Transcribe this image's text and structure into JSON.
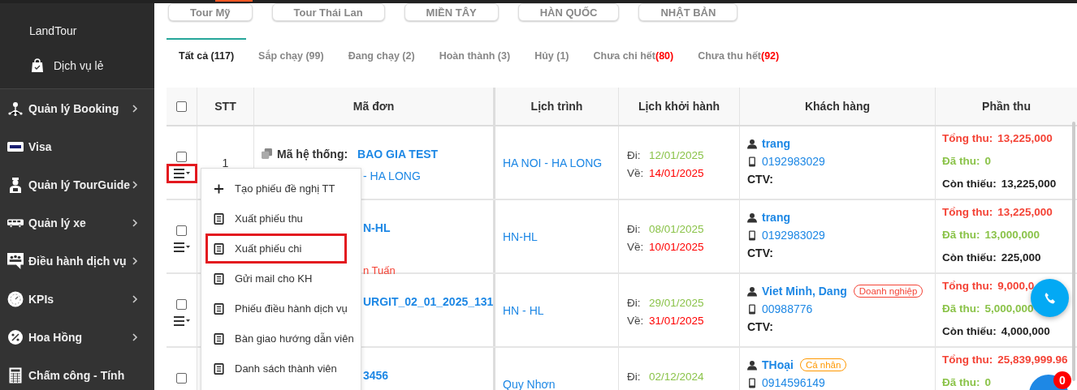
{
  "sidebar": {
    "brand_items": [
      {
        "label": "LandTour"
      },
      {
        "label": "Dịch vụ lẻ"
      }
    ],
    "items": [
      {
        "label": "Quản lý Booking",
        "has_submenu": true
      },
      {
        "label": "Visa",
        "has_submenu": false
      },
      {
        "label": "Quản lý TourGuide",
        "has_submenu": true
      },
      {
        "label": "Quản lý xe",
        "has_submenu": true
      },
      {
        "label": "Điều hành dịch vụ",
        "has_submenu": true
      },
      {
        "label": "KPIs",
        "has_submenu": true
      },
      {
        "label": "Hoa Hồng",
        "has_submenu": true
      },
      {
        "label": "Chấm công - Tính",
        "has_submenu": false
      }
    ]
  },
  "category_buttons": [
    {
      "label": "Tour Mỹ"
    },
    {
      "label": "Tour Thái Lan"
    },
    {
      "label": "MIỀN TÂY"
    },
    {
      "label": "HÀN QUỐC"
    },
    {
      "label": "NHẬT BẢN"
    }
  ],
  "status_tabs": [
    {
      "label": "Tất cả (117)",
      "selected": true
    },
    {
      "label": "Sắp chạy (99)",
      "selected": false
    },
    {
      "label": "Đang chạy (2)",
      "selected": false
    },
    {
      "label": "Hoàn thành (3)",
      "selected": false
    },
    {
      "label": "Hủy (1)",
      "selected": false
    },
    {
      "label": "Chưa chi hết",
      "count": "(80)",
      "selected": false
    },
    {
      "label": "Chưa thu hết",
      "count": "(92)",
      "selected": false
    }
  ],
  "table": {
    "select_all_checked": false,
    "columns": [
      "STT",
      "Mã đơn",
      "Lịch trình",
      "Lịch khởi hành",
      "Khách hàng",
      "Phần thu"
    ],
    "rows": [
      {
        "checked": false,
        "menu_toggle": {
          "highlighted": true
        },
        "stt": "1",
        "code_lines": [
          {
            "kind": "system",
            "label": "Mã hệ thống:",
            "value": "BAO GIA TEST"
          },
          {
            "kind": "tour",
            "value": "- HA LONG"
          }
        ],
        "route": "HA NOI - HA LONG",
        "departure": {
          "go_label": "Đi:",
          "go_date": "12/01/2025",
          "return_label": "Về:",
          "return_date": "14/01/2025"
        },
        "customer": {
          "name": "trang",
          "phone": "0192983029",
          "ctv_label": "CTV:"
        },
        "payment": [
          {
            "kind": "total",
            "label": "Tổng thu:",
            "value": "13,225,000"
          },
          {
            "kind": "paid",
            "label": "Đã thu:",
            "value": "0"
          },
          {
            "kind": "due",
            "label": "Còn thiếu:",
            "value": "13,225,000"
          }
        ]
      },
      {
        "checked": false,
        "menu_toggle": {
          "highlighted": false
        },
        "code_lines": [
          {
            "kind": "code",
            "value": "N-HL"
          },
          {
            "kind": "note",
            "value": "n Tuấn"
          }
        ],
        "route": "HN-HL",
        "departure": {
          "go_label": "Đi:",
          "go_date": "08/01/2025",
          "return_label": "Về:",
          "return_date": "10/01/2025"
        },
        "customer": {
          "name": "trang",
          "phone": "0192983029",
          "ctv_label": "CTV:"
        },
        "payment": [
          {
            "kind": "total",
            "label": "Tổng thu:",
            "value": "13,225,000"
          },
          {
            "kind": "paid",
            "label": "Đã thu:",
            "value": "13,000,000"
          },
          {
            "kind": "due",
            "label": "Còn thiếu:",
            "value": "225,000"
          }
        ]
      },
      {
        "checked": false,
        "menu_toggle": {
          "highlighted": false
        },
        "code_lines": [
          {
            "kind": "code",
            "value": "URGIT_02_01_2025_131"
          }
        ],
        "route": "HN - HL",
        "departure": {
          "go_label": "Đi:",
          "go_date": "29/01/2025",
          "return_label": "Về:",
          "return_date": "31/01/2025"
        },
        "customer": {
          "name": "Viet Minh, Dang",
          "tag": {
            "label": "Doanh nghiệp",
            "color": "#f44336"
          },
          "phone": "00988776",
          "ctv_label": "CTV:"
        },
        "payment": [
          {
            "kind": "total",
            "label": "Tổng thu:",
            "value": "9,000,0"
          },
          {
            "kind": "paid",
            "label": "Đã thu:",
            "value": "5,000,000"
          },
          {
            "kind": "due",
            "label": "Còn thiếu:",
            "value": "4,000,000"
          }
        ]
      },
      {
        "checked": false,
        "code_lines": [
          {
            "kind": "code",
            "value": "3456"
          }
        ],
        "route": "Quy Nhơn",
        "departure": {
          "go_label": "Đi:",
          "go_date": "02/12/2024"
        },
        "customer": {
          "name": "THoại",
          "tag": {
            "label": "Cá nhân",
            "color": "#ff9800"
          },
          "phone": "0914596149"
        },
        "payment": [
          {
            "kind": "total",
            "label": "Tổng thu:",
            "value": "25,839,999.96"
          },
          {
            "kind": "paid",
            "label": "Đã thu:",
            "value": "0"
          }
        ]
      }
    ]
  },
  "action_menu": {
    "items": [
      {
        "kind": "add",
        "label": "Tạo phiếu đề nghị TT",
        "highlighted": false
      },
      {
        "kind": "document",
        "label": "Xuất phiếu thu",
        "highlighted": false
      },
      {
        "kind": "document",
        "label": "Xuất phiếu chi",
        "highlighted": true
      },
      {
        "kind": "document",
        "label": "Gửi mail cho KH",
        "highlighted": false
      },
      {
        "kind": "document",
        "label": "Phiếu điều hành dịch vụ",
        "highlighted": false
      },
      {
        "kind": "document",
        "label": "Bàn giao hướng dẫn viên",
        "highlighted": false
      },
      {
        "kind": "document",
        "label": "Danh sách thành viên",
        "highlighted": false
      }
    ]
  },
  "chat_badge": {
    "count": "0"
  }
}
